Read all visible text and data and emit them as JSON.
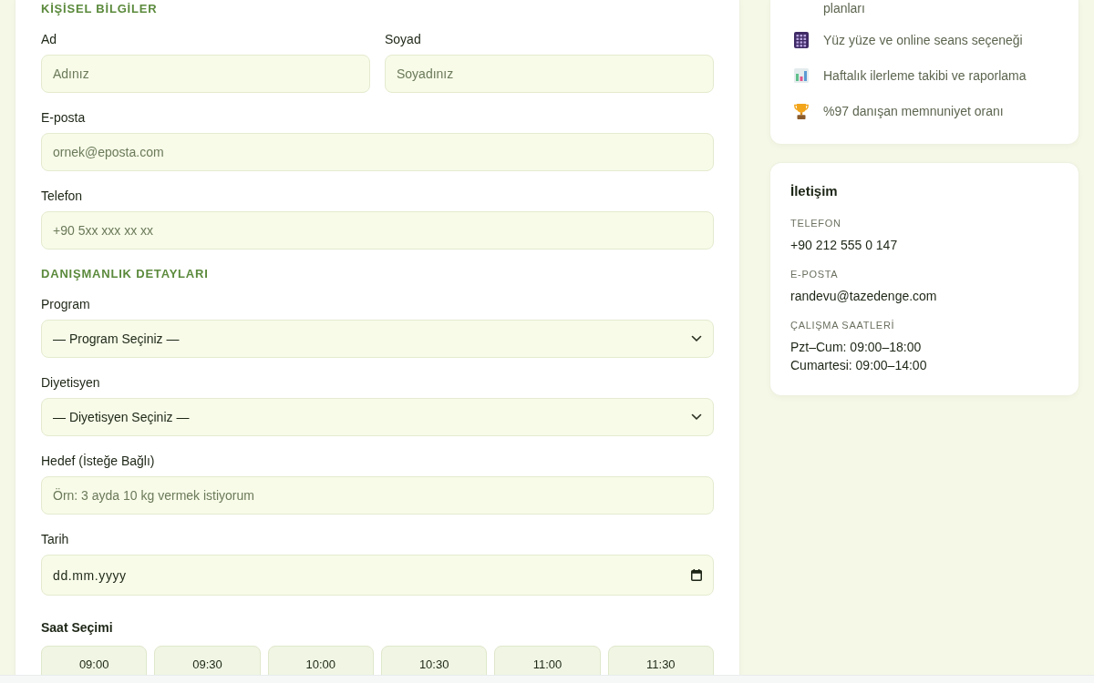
{
  "form": {
    "sections": [
      {
        "title": "KİŞİSEL BİLGİLER",
        "rows": [
          {
            "fields": [
              {
                "kind": "text",
                "label": "Ad",
                "placeholder": "Adınız"
              },
              {
                "kind": "text",
                "label": "Soyad",
                "placeholder": "Soyadınız"
              }
            ]
          },
          {
            "fields": [
              {
                "kind": "text",
                "label": "E-posta",
                "placeholder": "ornek@eposta.com"
              }
            ]
          },
          {
            "fields": [
              {
                "kind": "text",
                "label": "Telefon",
                "placeholder": "+90 5xx xxx xx xx"
              }
            ]
          }
        ]
      },
      {
        "title": "DANIŞMANLIK DETAYLARI",
        "rows": [
          {
            "fields": [
              {
                "kind": "select",
                "label": "Program",
                "value": "— Program Seçiniz —"
              }
            ]
          },
          {
            "fields": [
              {
                "kind": "select",
                "label": "Diyetisyen",
                "value": "— Diyetisyen Seçiniz —"
              }
            ]
          },
          {
            "fields": [
              {
                "kind": "text",
                "label": "Hedef (İsteğe Bağlı)",
                "placeholder": "Örn: 3 ayda 10 kg vermek istiyorum"
              }
            ]
          },
          {
            "fields": [
              {
                "kind": "date",
                "label": "Tarih",
                "placeholder": "dd.mm.yyyy"
              }
            ]
          }
        ]
      }
    ],
    "time_slots": {
      "label": "Saat Seçimi",
      "slots": [
        {
          "label": "09:00",
          "selected": false
        },
        {
          "label": "09:30",
          "selected": false
        },
        {
          "label": "10:00",
          "selected": false
        },
        {
          "label": "10:30",
          "selected": false
        },
        {
          "label": "11:00",
          "selected": false
        },
        {
          "label": "11:30",
          "selected": false
        }
      ]
    }
  },
  "sidebar": {
    "features": [
      {
        "kind": "continuation",
        "text": "planları"
      },
      {
        "kind": "calendar",
        "text": "Yüz yüze ve online seans seçeneği"
      },
      {
        "kind": "chart",
        "text": "Haftalık ilerleme takibi ve raporlama"
      },
      {
        "kind": "trophy",
        "text": "%97 danışan memnuniyet oranı"
      }
    ],
    "contact": {
      "title": "İletişim",
      "items": [
        {
          "label": "TELEFON",
          "lines": [
            "+90 212 555 0 147"
          ]
        },
        {
          "label": "E-POSTA",
          "lines": [
            "randevu@tazedenge.com"
          ]
        },
        {
          "label": "ÇALIŞMA SAATLERİ",
          "lines": [
            "Pzt–Cum: 09:00–18:00",
            "Cumartesi: 09:00–14:00"
          ]
        }
      ]
    }
  }
}
